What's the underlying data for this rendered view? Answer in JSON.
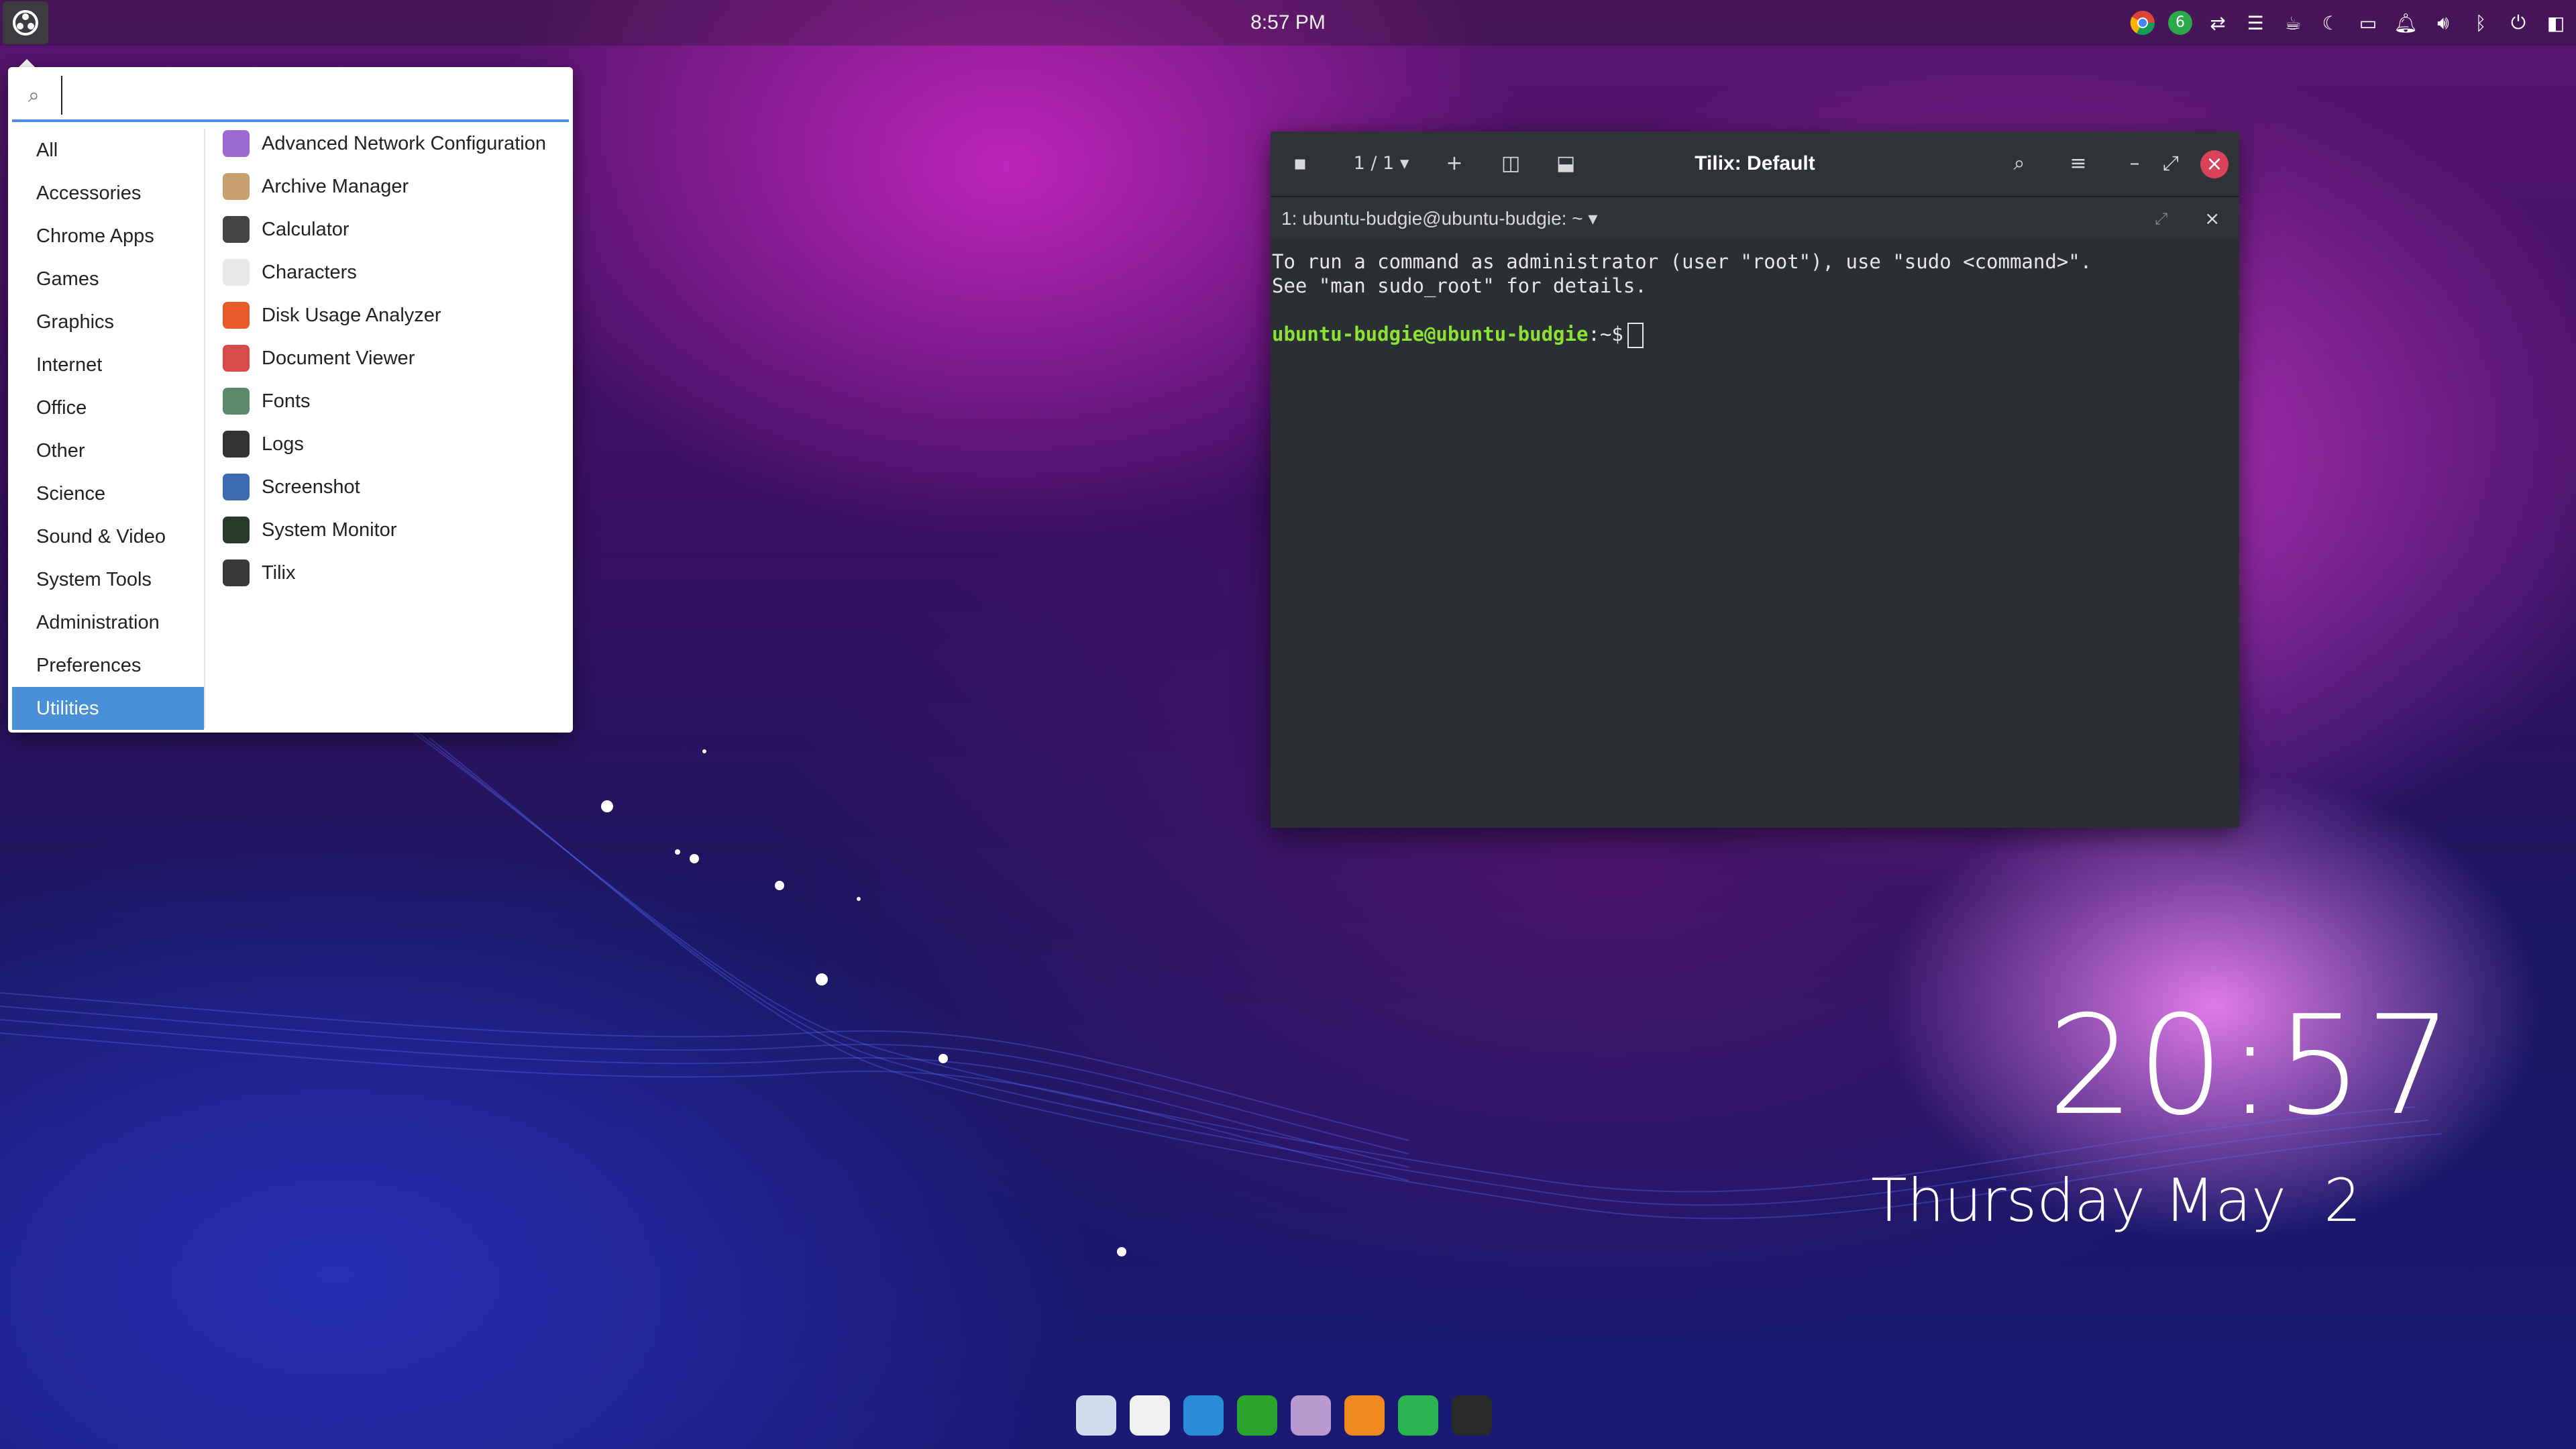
{
  "panel": {
    "clock": "8:57 PM",
    "tray_icons": [
      "chrome-icon",
      "update-badge-icon",
      "network-icon",
      "menu-lines-icon",
      "caffeine-icon",
      "night-light-icon",
      "files-icon",
      "notifications-icon",
      "volume-icon",
      "bluetooth-icon",
      "power-icon",
      "raven-icon"
    ],
    "update_count": "6"
  },
  "menu": {
    "search_placeholder": "",
    "categories": [
      "All",
      "Accessories",
      "Chrome Apps",
      "Games",
      "Graphics",
      "Internet",
      "Office",
      "Other",
      "Science",
      "Sound & Video",
      "System Tools",
      "Administration",
      "Preferences",
      "Utilities"
    ],
    "active_category": "Utilities",
    "apps": [
      {
        "label": "Advanced Network Configuration",
        "icon": "network-config-icon",
        "color": "#9b6bcf"
      },
      {
        "label": "Archive Manager",
        "icon": "archive-icon",
        "color": "#c8a070"
      },
      {
        "label": "Calculator",
        "icon": "calculator-icon",
        "color": "#444444"
      },
      {
        "label": "Characters",
        "icon": "characters-icon",
        "color": "#e8e8e8"
      },
      {
        "label": "Disk Usage Analyzer",
        "icon": "disk-usage-icon",
        "color": "#e85a2a"
      },
      {
        "label": "Document Viewer",
        "icon": "document-viewer-icon",
        "color": "#d94a4a"
      },
      {
        "label": "Fonts",
        "icon": "fonts-icon",
        "color": "#5a8a6a"
      },
      {
        "label": "Logs",
        "icon": "logs-icon",
        "color": "#333333"
      },
      {
        "label": "Screenshot",
        "icon": "screenshot-icon",
        "color": "#3a6ab0"
      },
      {
        "label": "System Monitor",
        "icon": "system-monitor-icon",
        "color": "#2a3a2a"
      },
      {
        "label": "Tilix",
        "icon": "tilix-icon",
        "color": "#3a3a3a"
      }
    ]
  },
  "terminal": {
    "title": "Tilix: Default",
    "tab_counter": "1 / 1",
    "session": "1: ubuntu-budgie@ubuntu-budgie: ~",
    "line1": "To run a command as administrator (user \"root\"), use \"sudo <command>\".",
    "line2": "See \"man sudo_root\" for details.",
    "prompt_user": "ubuntu-budgie@ubuntu-budgie",
    "prompt_rest": ":~$"
  },
  "desktop": {
    "time": "20:57",
    "date": "Thursday May  2"
  },
  "dock": [
    {
      "icon": "budgie-welcome-icon",
      "color": "#d0dcee"
    },
    {
      "icon": "music-icon",
      "color": "#f0f0f0"
    },
    {
      "icon": "writer-icon",
      "color": "#2a8bd6"
    },
    {
      "icon": "calc-spreadsheet-icon",
      "color": "#2aa42a"
    },
    {
      "icon": "files-icon",
      "color": "#b89ad0"
    },
    {
      "icon": "firefox-icon",
      "color": "#f08a20"
    },
    {
      "icon": "chrome-icon",
      "color": "#2ab450"
    },
    {
      "icon": "terminal-icon",
      "color": "#2a2a2a"
    }
  ]
}
